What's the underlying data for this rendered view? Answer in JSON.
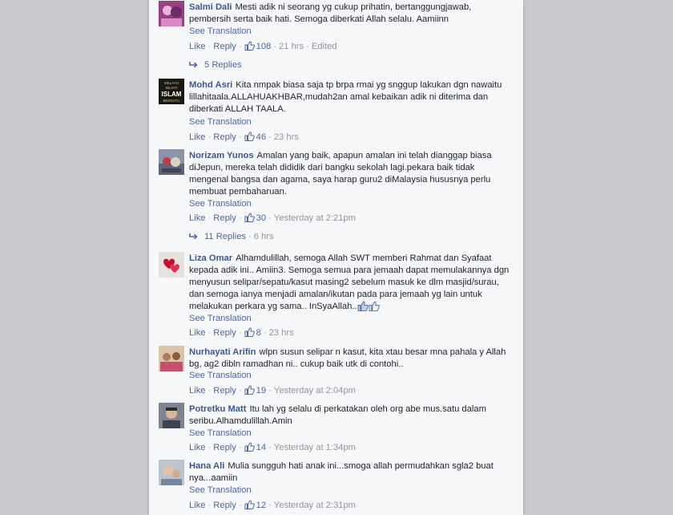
{
  "comments": [
    {
      "author": "Salmi Dali",
      "text": "Mesti adik ni seorang yg cukup prihatin, bertanggungjawab, pembersih serta baik hati. Semoga diberkati Allah selalu. Aamiinn",
      "see_translation": "See Translation",
      "like": "Like",
      "reply": "Reply",
      "likes": "108",
      "age": "21 hrs",
      "edited": "Edited",
      "replies": "5 Replies"
    },
    {
      "author": "Mohd Asri",
      "text": "Kita nmpak biasa saja tp brpa rmai yg snggup lakukan dgn nawaitu lillahitaala.ALLAHUAKHBAR,mudah2an amal kebaikan adik ni diterima dan diberkati ALLAH TAALA.",
      "see_translation": "See Translation",
      "like": "Like",
      "reply": "Reply",
      "likes": "46",
      "age": "23 hrs"
    },
    {
      "author": "Norizam Yunos",
      "text": "Amalan yang baik, apapun amalan ini telah dianggap biasa diJepun, mereka telah dididik dari bangku sekolah lagi.pekara baik tidak mengenal bangsa dan agama, saya harap guru2 diMalaysia hususnya perlu membuat pembaharuan.",
      "see_translation": "See Translation",
      "like": "Like",
      "reply": "Reply",
      "likes": "30",
      "age": "Yesterday at 2:21pm",
      "replies": "11 Replies",
      "replies_age": "6 hrs"
    },
    {
      "author": "Liza Omar",
      "text": "Alhamdulillah, semoga Allah SWT memberi Rahmat dan Syafaat kepada adik ini.. Amiin3. Semoga semua para jemaah dapat memulakannya dgn menyusun selipar/sepatu/kasut masing2 sebelum masuk ke dlm masjid/surau, dan semoga ianya menjadi amalan/ikutan pada para jemaah yg lain untuk melakukan perkara yg sama.. InSyaAllah..",
      "see_translation": "See Translation",
      "like": "Like",
      "reply": "Reply",
      "likes": "8",
      "age": "23 hrs"
    },
    {
      "author": "Nurhayati Arifin",
      "text": "wlpn susun selipar n kasut, kita xtau besar mna pahala y Allah bg, ag2 dibln ramadhan ni.. cukup baik utk di contohi..",
      "see_translation": "See Translation",
      "like": "Like",
      "reply": "Reply",
      "likes": "19",
      "age": "Yesterday at 2:04pm"
    },
    {
      "author": "Potretku Matt",
      "text": "Itu lah yg selalu di perkatakan oleh org abe mus.satu dalam seribu.Alhamdulillah.Amin",
      "see_translation": "See Translation",
      "like": "Like",
      "reply": "Reply",
      "likes": "14",
      "age": "Yesterday at 1:34pm"
    },
    {
      "author": "Hana Ali",
      "text": "Mulia sungguh hati anak ini...smoga allah permudahkan sgla2 buat nya...aamiin",
      "see_translation": "See Translation",
      "like": "Like",
      "reply": "Reply",
      "likes": "12",
      "age": "Yesterday at 2:31pm"
    }
  ],
  "mohd_asri_avatar_text": "MELAYU SEJATI ISLAM BERSATU",
  "colors": {
    "link": "#4b67a1",
    "author": "#365899",
    "meta": "#90949c",
    "panel": "#f6f7f9",
    "backdrop": "#c9cbd0"
  },
  "icons": {
    "like": "thumbs-up-icon",
    "reply_thread": "reply-arrow-icon"
  }
}
